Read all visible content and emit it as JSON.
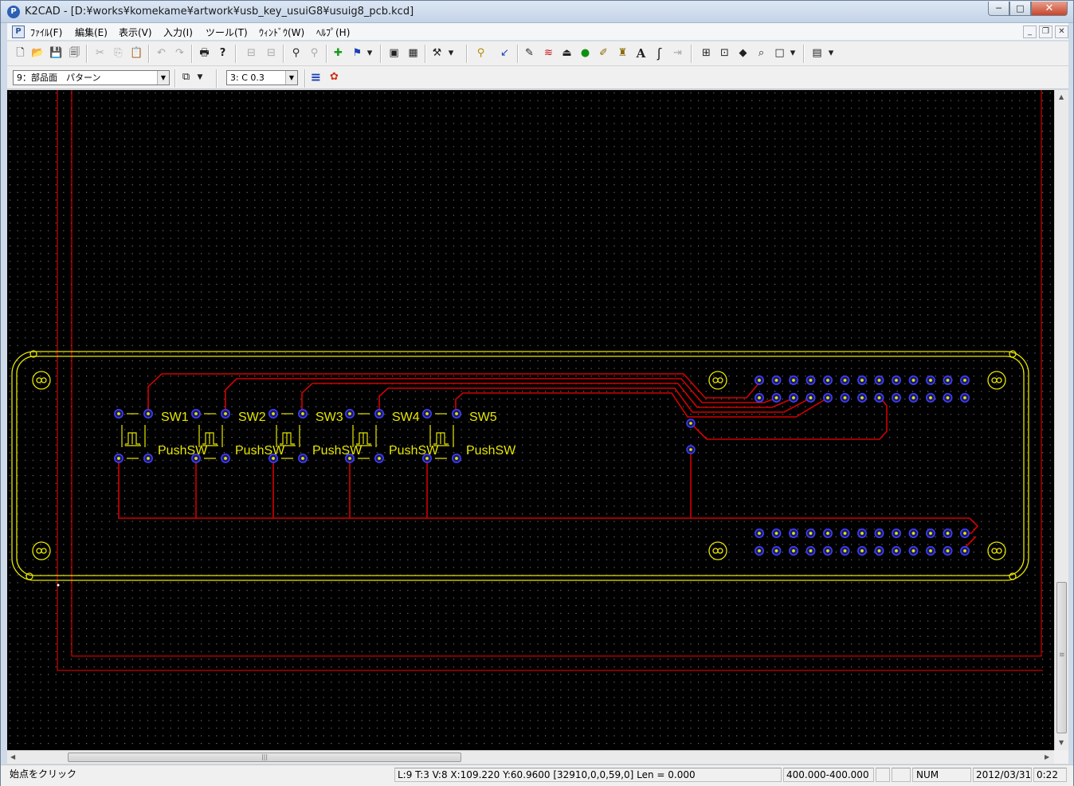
{
  "window": {
    "app_name": "K2CAD",
    "title": "K2CAD - [D:¥works¥komekame¥artwork¥usb_key_usuiG8¥usuig8_pcb.kcd]",
    "app_icon_glyph": "P"
  },
  "caption_buttons": {
    "minimize": "─",
    "maximize": "□",
    "close": "✕"
  },
  "mdi_buttons": {
    "minimize": "_",
    "restore": "❐",
    "close": "✕"
  },
  "menu": {
    "items": [
      "ﾌｧｲﾙ(F)",
      "編集(E)",
      "表示(V)",
      "入力(I)",
      "ツール(T)",
      "ｳｨﾝﾄﾞｳ(W)",
      "ﾍﾙﾌﾟ(H)"
    ]
  },
  "toolbar1": {
    "icons": [
      "new-file-icon",
      "open-folder-icon",
      "save-icon",
      "save-all-icon",
      "cut-icon",
      "copy-icon",
      "paste-icon",
      "undo-icon",
      "redo-icon",
      "print-icon",
      "help-icon",
      "layer-up-icon",
      "layer-down-icon",
      "find-icon",
      "find-next-icon",
      "add-part-icon",
      "flag-icon",
      "flag-dropdown-icon",
      "view-icon",
      "grid-icon",
      "hammer-icon",
      "hammer-dropdown-icon",
      "select-icon",
      "pointer-icon",
      "pencil-icon",
      "trace-icon",
      "component-icon",
      "pad-icon",
      "brush-icon",
      "trophy-icon",
      "text-icon",
      "arc-icon",
      "via-icon",
      "zoom-in-icon",
      "zoom-out-icon",
      "pan-icon",
      "zoom-icon",
      "window-icon",
      "window-dropdown-icon",
      "layout-icon",
      "layout-dropdown-icon"
    ],
    "glyphs": {
      "new": "🗋",
      "open": "📂",
      "save": "💾",
      "save_all": "🗐",
      "cut": "✂",
      "copy": "⎘",
      "paste": "📋",
      "undo": "↶",
      "redo": "↷",
      "print": "🖶",
      "help": "?",
      "layer_up": "⊟",
      "layer_down": "⊟",
      "find": "⚲",
      "find_next": "⚲",
      "add_part": "✚",
      "flag": "⚑",
      "dropdown": "▾",
      "view": "▣",
      "grid": "▦",
      "hammer": "⚒",
      "select": "⚲",
      "pointer": "↙",
      "pencil": "✎",
      "trace": "≋",
      "component": "⏏",
      "pad": "●",
      "brush": "✐",
      "trophy": "♜",
      "text": "A",
      "arc": "ʃ",
      "via": "⇥",
      "zoom_in": "⊞",
      "zoom_out": "⊡",
      "pan": "◆",
      "zoom": "⌕",
      "window": "□",
      "layout": "▤"
    }
  },
  "toolbar2": {
    "layer_select": "9：部品面　パターン",
    "layer_mode_glyph": "⧉",
    "width_select": "3: C 0.3",
    "lines_glyph": "≡",
    "colors_glyph": "✿",
    "dropdown": "▼"
  },
  "pcb": {
    "switches": [
      {
        "ref": "SW1",
        "value": "PushSW"
      },
      {
        "ref": "SW2",
        "value": "PushSW"
      },
      {
        "ref": "SW3",
        "value": "PushSW"
      },
      {
        "ref": "SW4",
        "value": "PushSW"
      },
      {
        "ref": "SW5",
        "value": "PushSW"
      }
    ],
    "colors": {
      "background": "#000000",
      "grid_dots": "#6f6f6f",
      "silk": "#e6e600",
      "copper": "#d40000",
      "pad_ring": "#4040ff",
      "board_outline": "#ff0000"
    }
  },
  "scrollbars": {
    "up": "▲",
    "down": "▼",
    "left": "◀",
    "right": "▶",
    "grip": "|||",
    "grip_v": "≡"
  },
  "statusbar": {
    "message": "始点をクリック",
    "coords": "L:9 T:3 V:8 X:109.220 Y:60.9600 [32910,0,0,59,0] Len = 0.000",
    "grid": "400.000-400.000",
    "num": "NUM",
    "date": "2012/03/31",
    "time": "0:22"
  }
}
